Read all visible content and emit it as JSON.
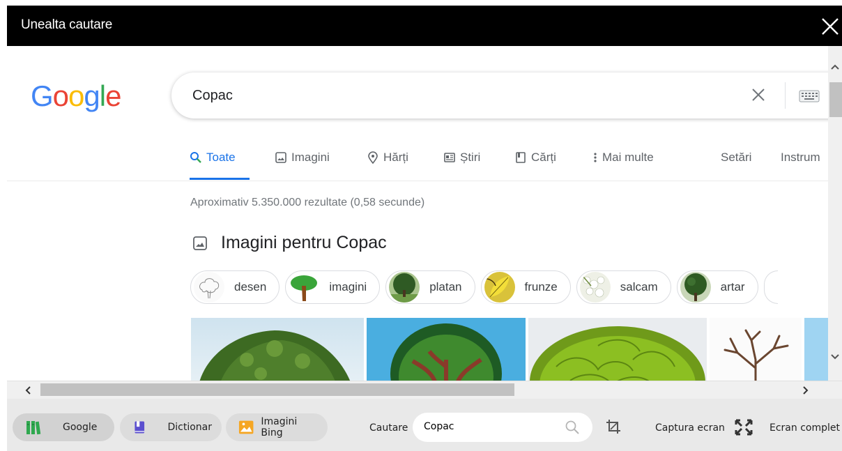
{
  "window": {
    "title": "Unealta cautare"
  },
  "google": {
    "logo_letters": [
      "G",
      "o",
      "o",
      "g",
      "l",
      "e"
    ],
    "logo_colors": [
      "#4285f4",
      "#ea4335",
      "#fbbc05",
      "#4285f4",
      "#34a853",
      "#ea4335"
    ],
    "query": "Copac",
    "tabs": [
      {
        "label": "Toate",
        "icon": "search-icon",
        "active": true
      },
      {
        "label": "Imagini",
        "icon": "image-icon"
      },
      {
        "label": "Hărți",
        "icon": "map-pin-icon"
      },
      {
        "label": "Știri",
        "icon": "news-icon"
      },
      {
        "label": "Cărți",
        "icon": "book-icon"
      },
      {
        "label": "Mai multe",
        "icon": "more-vert-icon"
      },
      {
        "label": "Setări"
      },
      {
        "label": "Instrum"
      }
    ],
    "stats": "Aproximativ 5.350.000 rezultate (0,58 secunde)",
    "images_heading": "Imagini pentru Copac",
    "chips": [
      "desen",
      "imagini",
      "platan",
      "frunze",
      "salcam",
      "artar"
    ],
    "accent": "#1a73e8"
  },
  "toolbar": {
    "buttons": [
      {
        "label": "Google",
        "icon": "books-icon",
        "active": true
      },
      {
        "label": "Dictionar",
        "icon": "dictionary-icon"
      },
      {
        "label": "Imagini Bing",
        "icon": "picture-icon"
      }
    ],
    "search_label": "Cautare",
    "search_value": "Copac",
    "capture_label": "Captura ecran",
    "fullscreen_label": "Ecran complet"
  }
}
